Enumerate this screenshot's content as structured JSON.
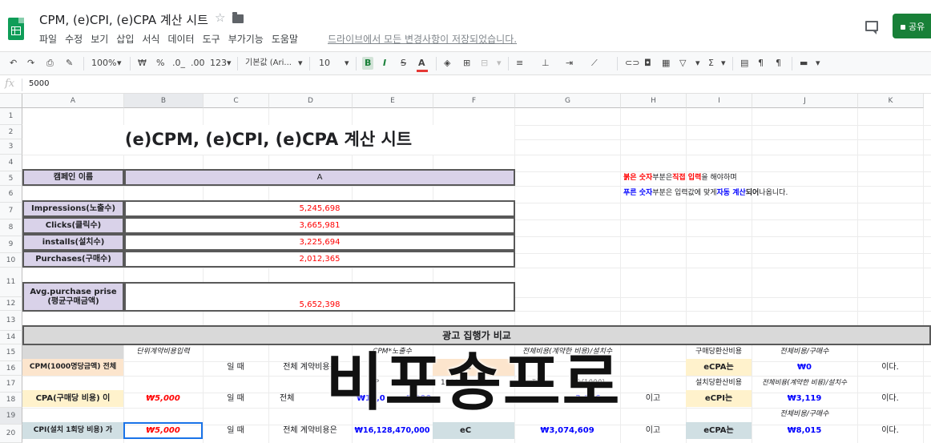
{
  "app": {
    "title": "CPM, (e)CPI, (e)CPA 계산 시트",
    "save_status": "드라이브에서 모든 변경사항이 저장되었습니다.",
    "share_label": "공유",
    "menu": [
      "파일",
      "수정",
      "보기",
      "삽입",
      "서식",
      "데이터",
      "도구",
      "부가기능",
      "도움말"
    ]
  },
  "toolbar": {
    "zoom": "100%",
    "currency": "₩",
    "percent": "%",
    "decimal_decrease": ".0_",
    "decimal_increase": ".00",
    "more_formats": "123",
    "font": "기본값 (Ari...",
    "font_size": "10",
    "bold": "B",
    "italic": "I",
    "strike": "S",
    "text_color": "A"
  },
  "formula_bar": {
    "fx": "fx",
    "value": "5000"
  },
  "columns": [
    "A",
    "B",
    "C",
    "D",
    "E",
    "F",
    "G",
    "H",
    "I",
    "J",
    "K"
  ],
  "rows": [
    "1",
    "2",
    "3",
    "4",
    "5",
    "6",
    "7",
    "8",
    "9",
    "10",
    "11",
    "12",
    "13",
    "14",
    "15",
    "16",
    "17",
    "18",
    "19",
    "20"
  ],
  "sheet": {
    "title": "(e)CPM, (e)CPI, (e)CPA 계산 시트",
    "campaign_label": "캠페인 이름",
    "campaign_value": "A",
    "note1": {
      "p1": "붉은 숫자",
      "p2": " 부분은 ",
      "p3": "직접 입력",
      "p4": "을 해야하며"
    },
    "note2": {
      "p1": "푸른 숫자",
      "p2": " 부분은 입력값에 맞게 ",
      "p3": "자동 계산",
      "p4": "되어",
      "p5": " 나옵니다."
    },
    "metrics": [
      {
        "label": "Impressions(노출수)",
        "value": "5,245,698"
      },
      {
        "label": "Clicks(클릭수)",
        "value": "3,665,981"
      },
      {
        "label": "installs(설치수)",
        "value": "3,225,694"
      },
      {
        "label": "Purchases(구매수)",
        "value": "2,012,365"
      }
    ],
    "avg_label_1": "Avg.purchase prise",
    "avg_label_2": "(평균구매금액)",
    "avg_value": "5,652,398",
    "section_title": "광고 집행가 비교",
    "r14": {
      "b": "단위계약비용입력",
      "e": "CPM*노출수",
      "g": "전체비용(계약한 비용)/설치수",
      "i": "구매당환산비용",
      "j": "전체비용/구매수"
    },
    "r15": {
      "a": "CPM(1000명당금액) 전체",
      "c": "일 때",
      "d": "전체 계약비용은",
      "f": "eC",
      "i": "eCPA는",
      "j": "₩0",
      "k": "이다."
    },
    "r16": {
      "e": "CP",
      "f": "1000",
      "g": "전체",
      "g2": "수(1000)",
      "i": "설치당환산비용",
      "j": "전체비용(계약한 비용)/설치수"
    },
    "r17": {
      "a": "CPA(구매당 비용) 이",
      "b": "₩5,000",
      "c": "일 때",
      "d": "전체",
      "e": "₩10,0",
      "e2": "5,000",
      "g2": "3,116",
      "h": "이고",
      "i": "eCPI는",
      "j": "₩3,119",
      "k": "이다."
    },
    "r18": {
      "j": "전체비용/구매수"
    },
    "r19": {
      "a": "CPI(설치 1회당 비용) 가",
      "b": "₩5,000",
      "c": "일 때",
      "d": "전체 계약비용은",
      "e": "₩16,128,470,000",
      "f": "eC",
      "g": "₩3,074,609",
      "h": "이고",
      "i": "eCPA는",
      "j": "₩8,015",
      "k": "이다."
    },
    "watermark": "비포숑프로"
  }
}
